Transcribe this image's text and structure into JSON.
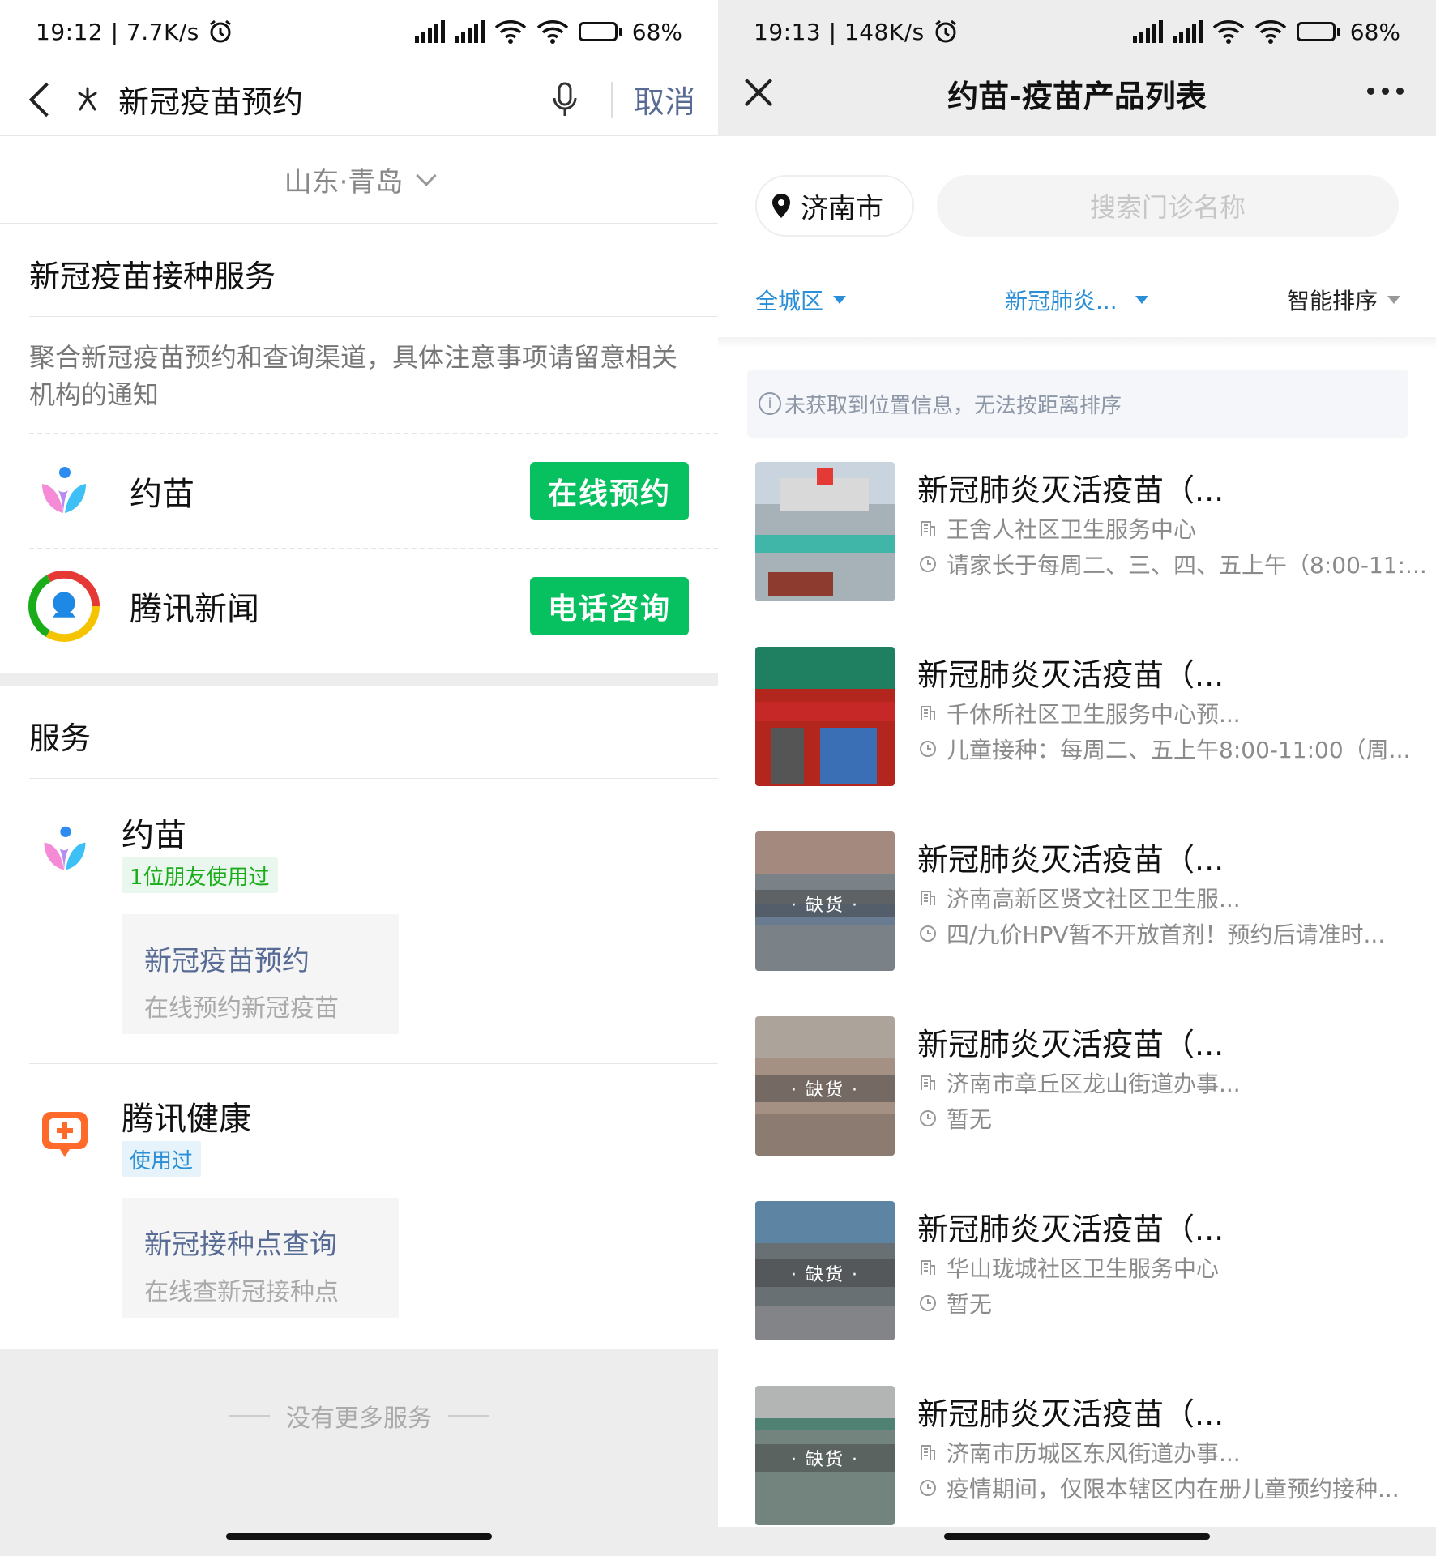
{
  "left": {
    "status": {
      "time": "19:12 | 7.7K/s",
      "battery": "68%",
      "battery_level": 0.68
    },
    "search": {
      "query": "新冠疫苗预约",
      "cancel": "取消"
    },
    "region": "山东·青岛",
    "service_section": {
      "title": "新冠疫苗接种服务",
      "description": "聚合新冠疫苗预约和查询渠道，具体注意事项请留意相关机构的通知",
      "rows": [
        {
          "name": "约苗",
          "button": "在线预约"
        },
        {
          "name": "腾讯新闻",
          "button": "电话咨询"
        }
      ]
    },
    "services": {
      "title": "服务",
      "items": [
        {
          "name": "约苗",
          "tag": "1位朋友使用过",
          "card_title": "新冠疫苗预约",
          "card_sub": "在线预约新冠疫苗"
        },
        {
          "name": "腾讯健康",
          "tag": "使用过",
          "card_title": "新冠接种点查询",
          "card_sub": "在线查新冠接种点"
        }
      ]
    },
    "footer": "没有更多服务"
  },
  "right": {
    "status": {
      "time": "19:13 | 148K/s",
      "battery": "68%",
      "battery_level": 0.68
    },
    "title": "约苗-疫苗产品列表",
    "city": "济南市",
    "search_placeholder": "搜索门诊名称",
    "filters": {
      "district": "全城区",
      "vaccine": "新冠肺炎...",
      "sort": "智能排序"
    },
    "notice": "未获取到位置信息，无法按距离排序",
    "items": [
      {
        "title": "新冠肺炎灭活疫苗（...",
        "clinic": "王舍人社区卫生服务中心",
        "hours": "请家长于每周二、三、四、五上午（8:00-11:...",
        "stock": ""
      },
      {
        "title": "新冠肺炎灭活疫苗（...",
        "clinic": "千休所社区卫生服务中心预...",
        "hours": "儿童接种：每周二、五上午8:00-11:00（周...",
        "stock": ""
      },
      {
        "title": "新冠肺炎灭活疫苗（...",
        "clinic": "济南高新区贤文社区卫生服...",
        "hours": "四/九价HPV暂不开放首剂！预约后请准时...",
        "stock": "· 缺货 ·"
      },
      {
        "title": "新冠肺炎灭活疫苗（...",
        "clinic": "济南市章丘区龙山街道办事...",
        "hours": "暂无",
        "stock": "· 缺货 ·"
      },
      {
        "title": "新冠肺炎灭活疫苗（...",
        "clinic": "华山珑城社区卫生服务中心",
        "hours": "暂无",
        "stock": "· 缺货 ·"
      },
      {
        "title": "新冠肺炎灭活疫苗（...",
        "clinic": "济南市历城区东风街道办事...",
        "hours": "疫情期间，仅限本辖区内在册儿童预约接种...",
        "stock": "· 缺货 ·"
      }
    ]
  },
  "colors": {
    "green": "#07c160",
    "link": "#576b95",
    "filter_blue": "#2a8fd6"
  }
}
